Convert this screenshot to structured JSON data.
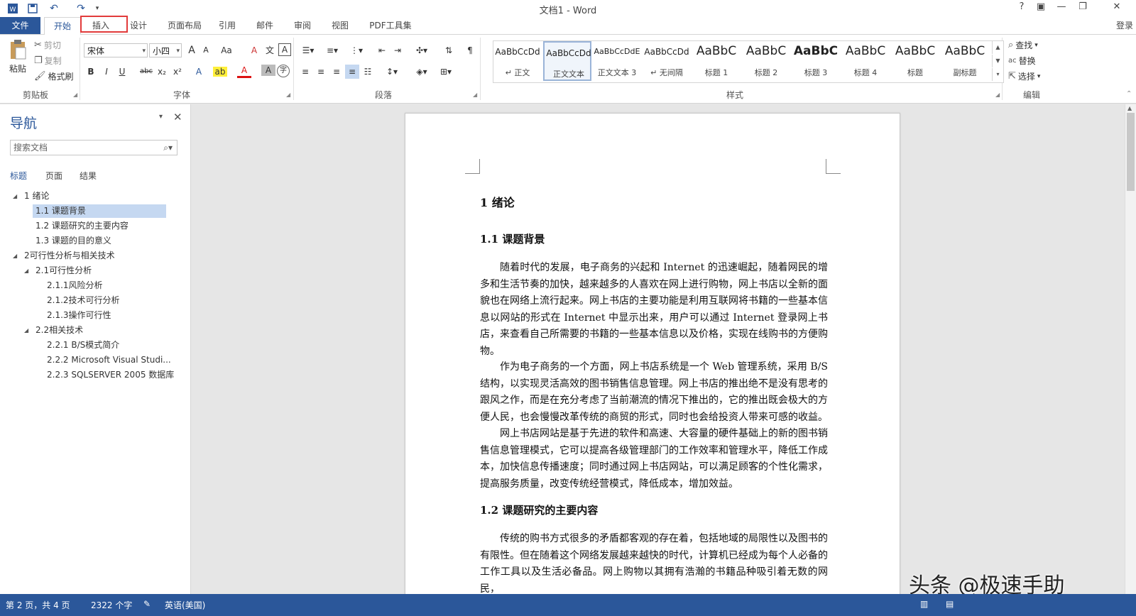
{
  "window": {
    "title": "文档1 - Word",
    "help": "?",
    "ribbon_display": "▣",
    "minimize": "—",
    "restore": "❐",
    "close": "✕",
    "login": "登录"
  },
  "qat": {
    "undo": "↶",
    "redo": "↷",
    "more": "▾"
  },
  "tabs": [
    {
      "label": "文件"
    },
    {
      "label": "开始"
    },
    {
      "label": "插入"
    },
    {
      "label": "设计"
    },
    {
      "label": "页面布局"
    },
    {
      "label": "引用"
    },
    {
      "label": "邮件"
    },
    {
      "label": "审阅"
    },
    {
      "label": "视图"
    },
    {
      "label": "PDF工具集"
    }
  ],
  "ribbon": {
    "clipboard": {
      "label": "剪贴板",
      "paste": "粘贴",
      "cut": "剪切",
      "copy": "复制",
      "format_painter": "格式刷"
    },
    "font": {
      "label": "字体",
      "font_name": "宋体",
      "font_size": "小四",
      "bold": "B",
      "italic": "I",
      "underline": "U",
      "strike": "abc",
      "subscript": "x₂",
      "superscript": "x²",
      "grow": "A",
      "shrink": "A",
      "case": "Aa",
      "clear": "A",
      "phonetic": "文",
      "border_char": "A",
      "effects": "A",
      "highlight": "ab",
      "color": "A",
      "shade": "A",
      "enclose": "字"
    },
    "paragraph": {
      "label": "段落"
    },
    "styles": {
      "label": "样式",
      "items": [
        {
          "preview": "AaBbCcDd",
          "name": "↵ 正文"
        },
        {
          "preview": "AaBbCcDd",
          "name": "正文文本"
        },
        {
          "preview": "AaBbCcDdE",
          "name": "正文文本 3"
        },
        {
          "preview": "AaBbCcDd",
          "name": "↵ 无间隔"
        },
        {
          "preview": "AaBbC",
          "name": "标题 1"
        },
        {
          "preview": "AaBbC",
          "name": "标题 2"
        },
        {
          "preview": "AaBbC",
          "name": "标题 3"
        },
        {
          "preview": "AaBbC",
          "name": "标题 4"
        },
        {
          "preview": "AaBbC",
          "name": "标题"
        },
        {
          "preview": "AaBbC",
          "name": "副标题"
        }
      ]
    },
    "editing": {
      "label": "编辑",
      "find": "查找",
      "replace": "替换",
      "select": "选择"
    }
  },
  "nav": {
    "title": "导航",
    "search_placeholder": "搜索文档",
    "tabs": [
      "标题",
      "页面",
      "结果"
    ],
    "tree": [
      {
        "label": "1   绪论"
      },
      {
        "label": "1.1 课题背景"
      },
      {
        "label": "1.2 课题研究的主要内容"
      },
      {
        "label": "1.3 课题的目的意义"
      },
      {
        "label": "2可行性分析与相关技术"
      },
      {
        "label": "2.1可行性分析"
      },
      {
        "label": "2.1.1风险分析"
      },
      {
        "label": "2.1.2技术可行分析"
      },
      {
        "label": "2.1.3操作可行性"
      },
      {
        "label": "2.2相关技术"
      },
      {
        "label": "2.2.1 B/S模式简介"
      },
      {
        "label": "2.2.2 Microsoft Visual Studi..."
      },
      {
        "label": "2.2.3 SQLSERVER 2005 数据库"
      }
    ]
  },
  "document": {
    "h1": "1    绪论",
    "h2_1": "1.1  课题背景",
    "p1": "随着时代的发展，电子商务的兴起和 Internet 的迅速崛起，随着网民的增多和生活节奏的加快，越来越多的人喜欢在网上进行购物，网上书店以全新的面貌也在网络上流行起来。网上书店的主要功能是利用互联网将书籍的一些基本信息以网站的形式在 Internet 中显示出来，用户可以通过 Internet 登录网上书店，来查看自己所需要的书籍的一些基本信息以及价格，实现在线购书的方便购物。",
    "p2": "作为电子商务的一个方面，网上书店系统是一个 Web 管理系统，采用 B/S 结构，以实现灵活高效的图书销售信息管理。网上书店的推出绝不是没有思考的跟风之作，而是在充分考虑了当前潮流的情况下推出的，它的推出既会极大的方便人民，也会慢慢改革传统的商贸的形式，同时也会给投资人带来可感的收益。",
    "p3": "网上书店网站是基于先进的软件和高速、大容量的硬件基础上的新的图书销售信息管理模式，它可以提高各级管理部门的工作效率和管理水平，降低工作成本，加快信息传播速度；同时通过网上书店网站，可以满足顾客的个性化需求，提高服务质量，改变传统经营模式，降低成本，增加效益。",
    "h2_2": "1.2  课题研究的主要内容",
    "p4": "传统的购书方式很多的矛盾都客观的存在着，包括地域的局限性以及图书的有限性。但在随着这个网络发展越来越快的时代，计算机已经成为每个人必备的工作工具以及生活必备品。网上购物以其拥有浩瀚的书籍品种吸引着无数的网民，"
  },
  "status": {
    "page": "第 2 页，共 4 页",
    "words": "2322 个字",
    "language": "英语(美国)"
  },
  "watermark": "头条 @极速手助",
  "colors": {
    "accent": "#2b579a",
    "highlight_box": "#e23b3b",
    "selected_nav": "#c5d8f1"
  }
}
